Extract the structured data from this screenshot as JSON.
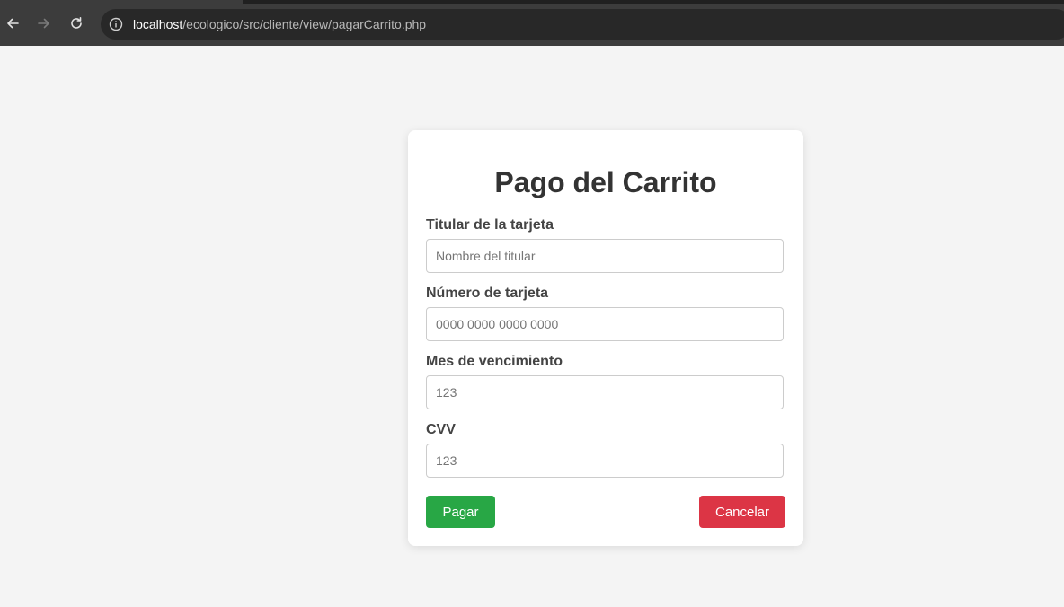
{
  "browser": {
    "url_host": "localhost",
    "url_path": "/ecologico/src/cliente/view/pagarCarrito.php"
  },
  "form": {
    "title": "Pago del Carrito",
    "fields": [
      {
        "label": "Titular de la tarjeta",
        "placeholder": "Nombre del titular",
        "value": ""
      },
      {
        "label": "Número de tarjeta",
        "placeholder": "0000 0000 0000 0000",
        "value": ""
      },
      {
        "label": "Mes de vencimiento",
        "placeholder": "123",
        "value": ""
      },
      {
        "label": "CVV",
        "placeholder": "123",
        "value": ""
      }
    ],
    "pay_label": "Pagar",
    "cancel_label": "Cancelar"
  },
  "colors": {
    "pay_button": "#28a745",
    "cancel_button": "#dc3545",
    "page_background": "#f4f4f4"
  }
}
